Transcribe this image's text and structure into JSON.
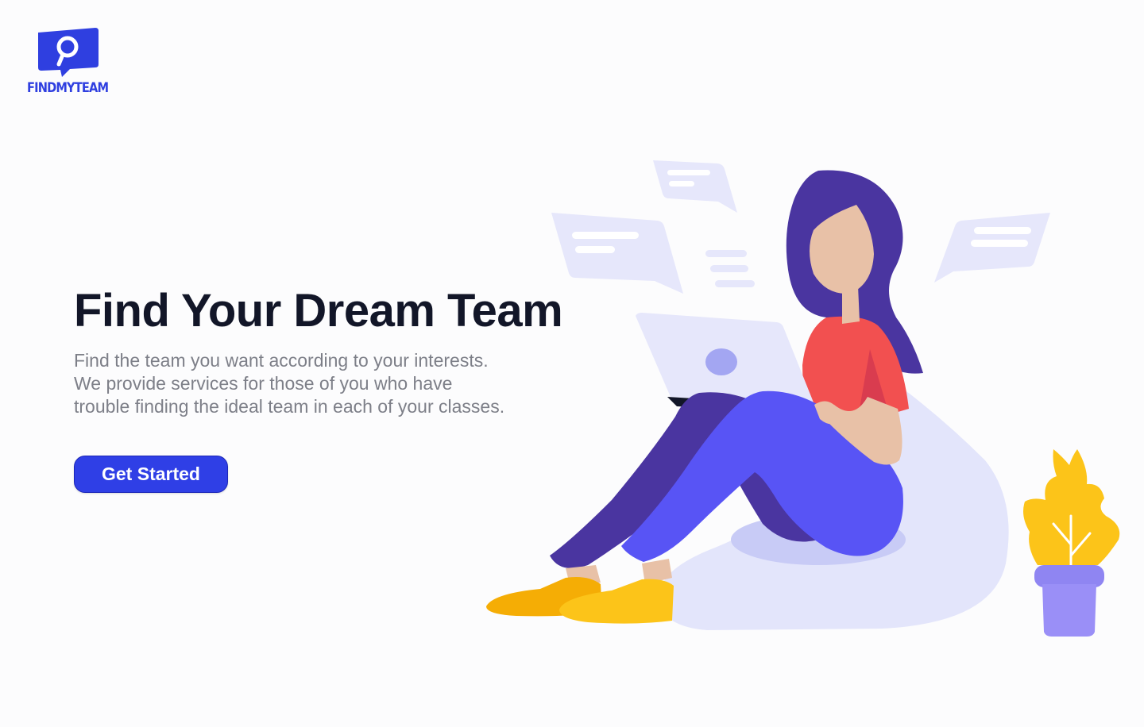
{
  "brand": {
    "name": "FINDMYTEAM",
    "logo_icon": "chat-magnifier-icon",
    "color": "#2f3fe0"
  },
  "hero": {
    "title": "Find Your Dream Team",
    "description_lines": [
      "Find the team you want according to your interests.",
      "We provide services for those of you who have",
      "trouble finding the ideal team in each of your classes."
    ],
    "cta_label": "Get Started"
  },
  "colors": {
    "background": "#fcfcfd",
    "primary": "#2f3fe6",
    "title": "#121628",
    "body_text": "#7d7f88",
    "bubble": "#e6e7fb",
    "hair": "#4a35a0",
    "shirt": "#f25050",
    "pants": "#5854f5",
    "shoes": "#fcc419",
    "plant": "#fcc419",
    "pot": "#9a8ff7"
  },
  "illustration": {
    "subject": "woman-with-laptop-on-beanbag",
    "decor": [
      "chat-bubble-icon",
      "chat-bubble-icon",
      "chat-bubble-icon",
      "potted-plant-icon"
    ]
  }
}
